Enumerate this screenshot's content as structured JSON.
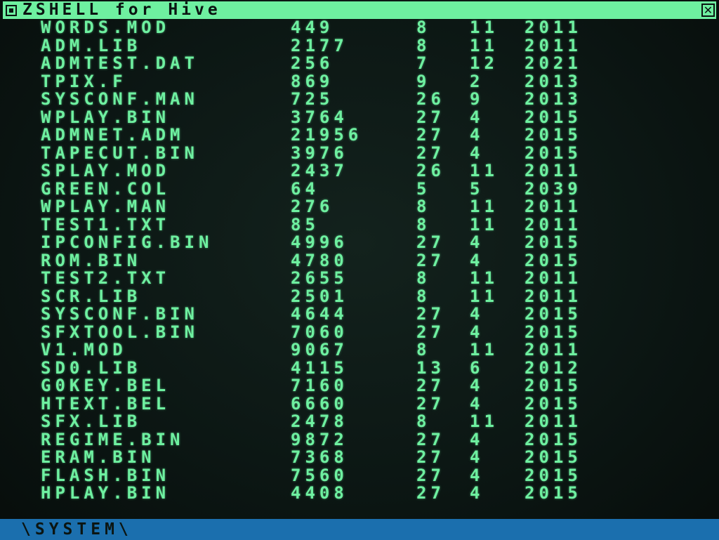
{
  "window": {
    "title": "ZSHELL for Hive",
    "close_glyph": "✕"
  },
  "colors": {
    "phosphor_green": "#6ef0a0",
    "background": "#0b1512",
    "status_bar": "#1b6fae"
  },
  "files": [
    {
      "name": "WORDS.MOD",
      "size": "449",
      "day": "8",
      "month": "11",
      "year": "2011"
    },
    {
      "name": "ADM.LIB",
      "size": "2177",
      "day": "8",
      "month": "11",
      "year": "2011"
    },
    {
      "name": "ADMTEST.DAT",
      "size": "256",
      "day": "7",
      "month": "12",
      "year": "2021"
    },
    {
      "name": "TPIX.F",
      "size": "869",
      "day": "9",
      "month": "2",
      "year": "2013"
    },
    {
      "name": "SYSCONF.MAN",
      "size": "725",
      "day": "26",
      "month": "9",
      "year": "2013"
    },
    {
      "name": "WPLAY.BIN",
      "size": "3764",
      "day": "27",
      "month": "4",
      "year": "2015"
    },
    {
      "name": "ADMNET.ADM",
      "size": "21956",
      "day": "27",
      "month": "4",
      "year": "2015"
    },
    {
      "name": "TAPECUT.BIN",
      "size": "3976",
      "day": "27",
      "month": "4",
      "year": "2015"
    },
    {
      "name": "SPLAY.MOD",
      "size": "2437",
      "day": "26",
      "month": "11",
      "year": "2011"
    },
    {
      "name": "GREEN.COL",
      "size": "64",
      "day": "5",
      "month": "5",
      "year": "2039"
    },
    {
      "name": "WPLAY.MAN",
      "size": "276",
      "day": "8",
      "month": "11",
      "year": "2011"
    },
    {
      "name": "TEST1.TXT",
      "size": "85",
      "day": "8",
      "month": "11",
      "year": "2011"
    },
    {
      "name": "IPCONFIG.BIN",
      "size": "4996",
      "day": "27",
      "month": "4",
      "year": "2015"
    },
    {
      "name": "ROM.BIN",
      "size": "4780",
      "day": "27",
      "month": "4",
      "year": "2015"
    },
    {
      "name": "TEST2.TXT",
      "size": "2655",
      "day": "8",
      "month": "11",
      "year": "2011"
    },
    {
      "name": "SCR.LIB",
      "size": "2501",
      "day": "8",
      "month": "11",
      "year": "2011"
    },
    {
      "name": "SYSCONF.BIN",
      "size": "4644",
      "day": "27",
      "month": "4",
      "year": "2015"
    },
    {
      "name": "SFXTOOL.BIN",
      "size": "7060",
      "day": "27",
      "month": "4",
      "year": "2015"
    },
    {
      "name": "V1.MOD",
      "size": "9067",
      "day": "8",
      "month": "11",
      "year": "2011"
    },
    {
      "name": "SD0.LIB",
      "size": "4115",
      "day": "13",
      "month": "6",
      "year": "2012"
    },
    {
      "name": "G0KEY.BEL",
      "size": "7160",
      "day": "27",
      "month": "4",
      "year": "2015"
    },
    {
      "name": "HTEXT.BEL",
      "size": "6660",
      "day": "27",
      "month": "4",
      "year": "2015"
    },
    {
      "name": "SFX.LIB",
      "size": "2478",
      "day": "8",
      "month": "11",
      "year": "2011"
    },
    {
      "name": "REGIME.BIN",
      "size": "9872",
      "day": "27",
      "month": "4",
      "year": "2015"
    },
    {
      "name": "ERAM.BIN",
      "size": "7368",
      "day": "27",
      "month": "4",
      "year": "2015"
    },
    {
      "name": "FLASH.BIN",
      "size": "7560",
      "day": "27",
      "month": "4",
      "year": "2015"
    },
    {
      "name": "HPLAY.BIN",
      "size": "4408",
      "day": "27",
      "month": "4",
      "year": "2015"
    }
  ],
  "status": {
    "path": "\\SYSTEM\\"
  }
}
